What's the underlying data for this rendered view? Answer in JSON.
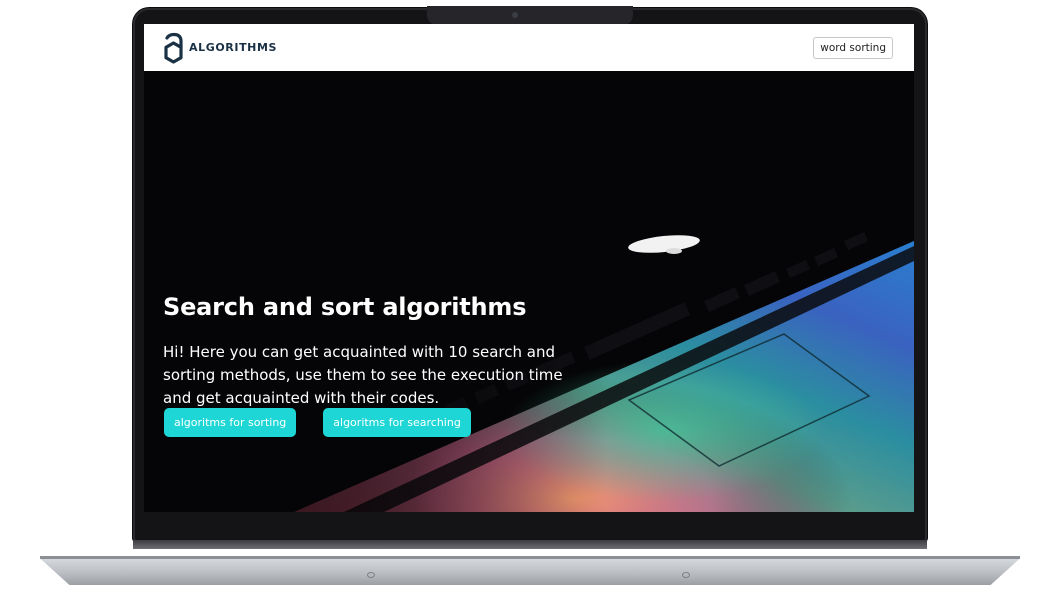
{
  "header": {
    "logo_text": "ALGORITHMS",
    "logo_icon": "a-hexagon-logo-icon",
    "nav_button_label": "word sorting"
  },
  "hero": {
    "title": "Search and sort algorithms",
    "description": "Hi! Here you can get acquainted with 10 search and sorting methods, use them to see the execution time and get acquainted with their codes.",
    "buttons": [
      {
        "label": "algoritms for sorting"
      },
      {
        "label": "algoritms for searching"
      }
    ]
  },
  "colors": {
    "accent": "#1ed6d6",
    "logo": "#1a3145",
    "hero_background": "#050507",
    "header_background": "#ffffff"
  }
}
